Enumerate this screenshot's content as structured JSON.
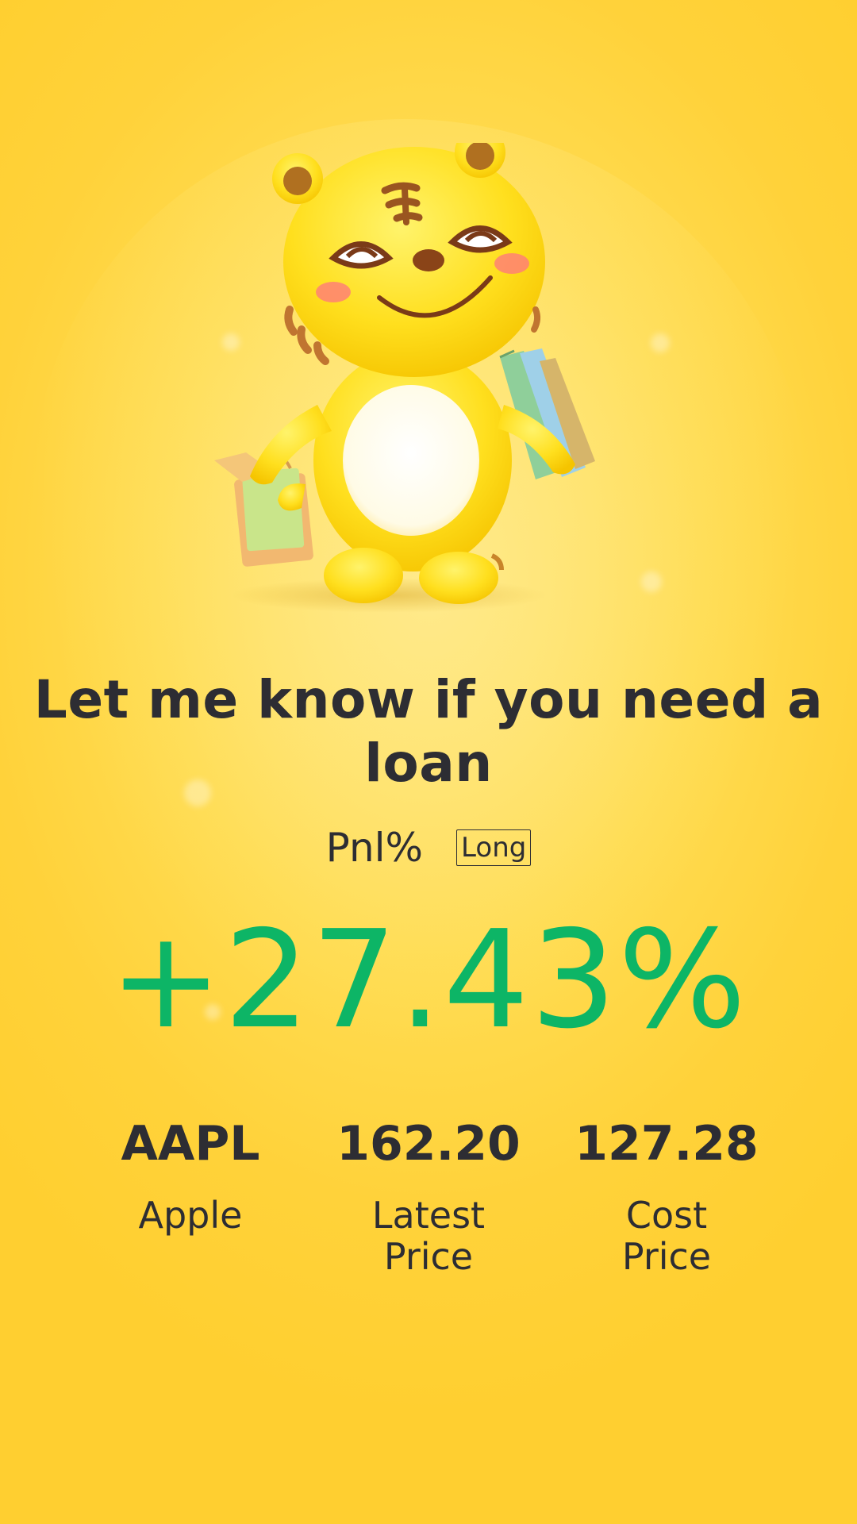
{
  "mascot": {
    "icon": "tiger-mascot-with-shopping-bags-icon"
  },
  "headline": "Let me know if you need a loan",
  "pnl": {
    "label": "Pnl%",
    "position_badge": "Long",
    "value": "+27.43%",
    "value_color": "#0db566"
  },
  "stats": [
    {
      "value": "AAPL",
      "label": "Apple"
    },
    {
      "value": "162.20",
      "label": "Latest\nPrice"
    },
    {
      "value": "127.28",
      "label": "Cost\nPrice"
    }
  ],
  "colors": {
    "background": "#ffd23a",
    "text": "#2d2d33",
    "profit": "#0db566"
  }
}
